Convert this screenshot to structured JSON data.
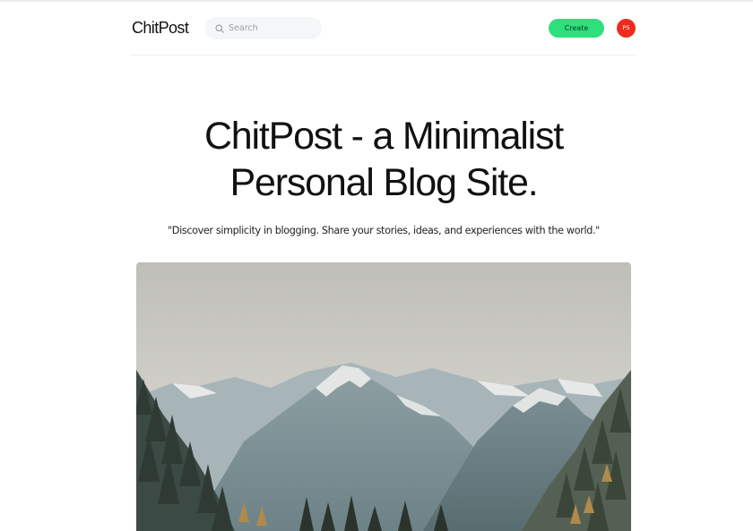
{
  "header": {
    "logo": "ChitPost",
    "search": {
      "placeholder": "Search",
      "value": ""
    },
    "create_label": "Create",
    "avatar_initials": "PS"
  },
  "hero": {
    "title_line1": "ChitPost - a Minimalist",
    "title_line2": "Personal Blog Site.",
    "subtitle": "\"Discover simplicity in blogging. Share your stories, ideas, and experiences with the world.\""
  },
  "image": {
    "icon": "mountain-landscape-photo"
  },
  "colors": {
    "accent": "#2ee07b",
    "avatar": "#f02a1e"
  }
}
